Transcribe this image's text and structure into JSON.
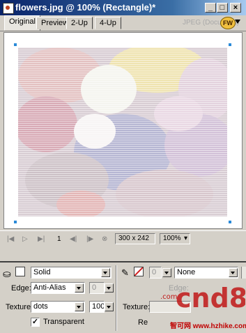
{
  "window": {
    "title": "flowers.jpg @ 100% (Rectangle)*",
    "controls": {
      "minimize": "_",
      "maximize": "□",
      "close": "×"
    }
  },
  "tabs": [
    {
      "label": "Original",
      "active": true
    },
    {
      "label": "Preview",
      "active": false
    },
    {
      "label": "2-Up",
      "active": false
    },
    {
      "label": "4-Up",
      "active": false
    }
  ],
  "doc_format_label": "JPEG (Document)",
  "logo_text": "FW",
  "status": {
    "frame_number": "1",
    "image_size": "300 x 242",
    "zoom": "100%"
  },
  "inspector": {
    "fill_type": "Solid",
    "edge_label": "Edge:",
    "edge_value": "Anti-Alias",
    "edge_feather": "0",
    "texture_label": "Texture:",
    "texture_value": "dots",
    "texture_amount": "100",
    "transparent_label": "Transparent",
    "transparent_checked": true,
    "stroke_size": "0",
    "stroke_type": "None",
    "stroke_edge_label": "Edge:",
    "stroke_texture_label": "Texture:",
    "stroke_bottom_label": "Re"
  },
  "watermark": {
    "logo": "cnd8",
    "com": ".com",
    "text": "智可网 www.hzhike.com"
  },
  "colors": {
    "title_bar": "#0a246a",
    "selection_handle": "#2a8ad8",
    "stroke_swatch": "#d02020"
  }
}
